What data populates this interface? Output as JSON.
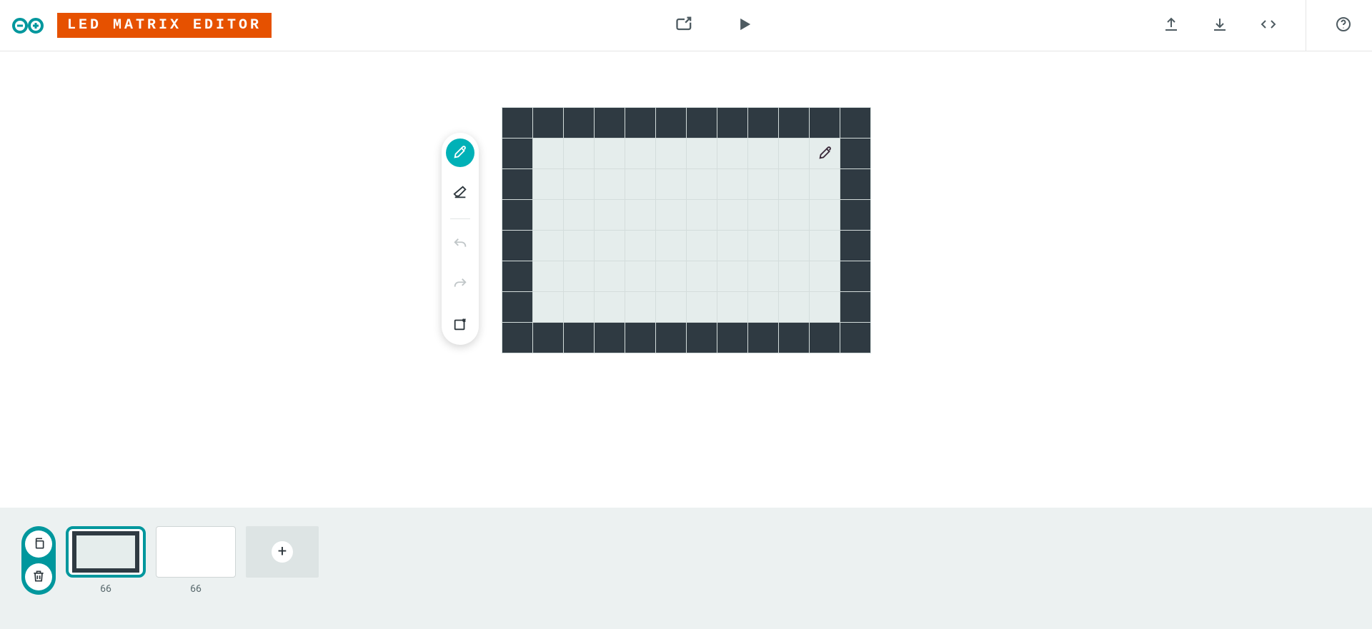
{
  "header": {
    "title": "LED MATRIX EDITOR"
  },
  "matrix": {
    "cols": 12,
    "rows": 8,
    "cells": [
      [
        1,
        1,
        1,
        1,
        1,
        1,
        1,
        1,
        1,
        1,
        1,
        1
      ],
      [
        1,
        0,
        0,
        0,
        0,
        0,
        0,
        0,
        0,
        0,
        0,
        1
      ],
      [
        1,
        0,
        0,
        0,
        0,
        0,
        0,
        0,
        0,
        0,
        0,
        1
      ],
      [
        1,
        0,
        0,
        0,
        0,
        0,
        0,
        0,
        0,
        0,
        0,
        1
      ],
      [
        1,
        0,
        0,
        0,
        0,
        0,
        0,
        0,
        0,
        0,
        0,
        1
      ],
      [
        1,
        0,
        0,
        0,
        0,
        0,
        0,
        0,
        0,
        0,
        0,
        1
      ],
      [
        1,
        0,
        0,
        0,
        0,
        0,
        0,
        0,
        0,
        0,
        0,
        1
      ],
      [
        1,
        1,
        1,
        1,
        1,
        1,
        1,
        1,
        1,
        1,
        1,
        1
      ]
    ],
    "cursor": {
      "row": 1,
      "col": 10
    }
  },
  "tools": {
    "brush": "brush",
    "eraser": "eraser",
    "undo": "undo",
    "redo": "redo",
    "clear": "clear",
    "active": "brush",
    "undo_enabled": false,
    "redo_enabled": false
  },
  "frames": [
    {
      "label": "66",
      "selected": true,
      "thumb": "border"
    },
    {
      "label": "66",
      "selected": false,
      "thumb": "blank"
    }
  ],
  "footer_actions": {
    "duplicate": "duplicate-frame",
    "delete": "delete-frame",
    "add": "+"
  },
  "header_icons": {
    "export_device": "export-to-device",
    "play": "play",
    "upload": "upload",
    "download": "download",
    "code": "code",
    "help": "help"
  }
}
